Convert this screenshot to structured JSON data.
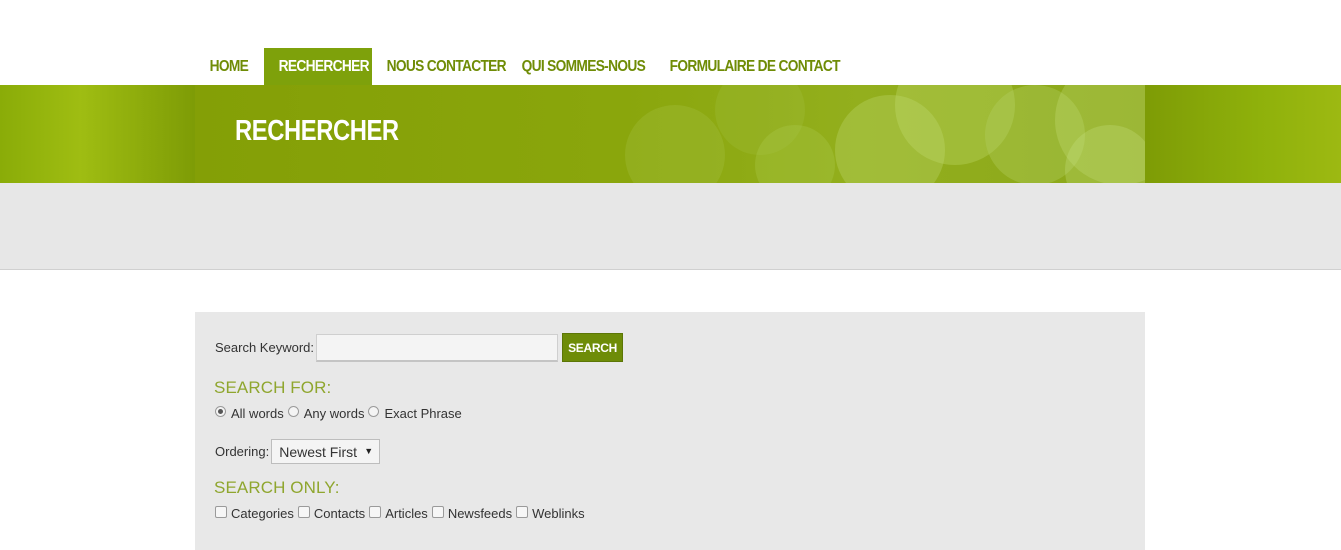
{
  "nav": {
    "items": [
      {
        "label": "HOME",
        "active": false
      },
      {
        "label": "RECHERCHER",
        "active": true
      },
      {
        "label": "NOUS CONTACTER",
        "active": false
      },
      {
        "label": "QUI SOMMES-NOUS",
        "active": false
      },
      {
        "label": "FORMULAIRE DE CONTACT",
        "active": false
      }
    ]
  },
  "banner": {
    "title": "RECHERCHER"
  },
  "search": {
    "keyword_label": "Search Keyword:",
    "keyword_value": "",
    "button_label": "SEARCH",
    "search_for_title": "SEARCH FOR:",
    "search_for_options": [
      {
        "label": "All words",
        "checked": true
      },
      {
        "label": "Any words",
        "checked": false
      },
      {
        "label": "Exact Phrase",
        "checked": false
      }
    ],
    "ordering_label": "Ordering:",
    "ordering_value": "Newest First",
    "search_only_title": "SEARCH ONLY:",
    "search_only_options": [
      {
        "label": "Categories",
        "checked": false
      },
      {
        "label": "Contacts",
        "checked": false
      },
      {
        "label": "Articles",
        "checked": false
      },
      {
        "label": "Newsfeeds",
        "checked": false
      },
      {
        "label": "Weblinks",
        "checked": false
      }
    ]
  },
  "colors": {
    "accent": "#7ea10b",
    "nav_text": "#6f8c06",
    "section_title": "#8fa62e",
    "button": "#6e8c08",
    "panel_bg": "#e8e8e8"
  }
}
